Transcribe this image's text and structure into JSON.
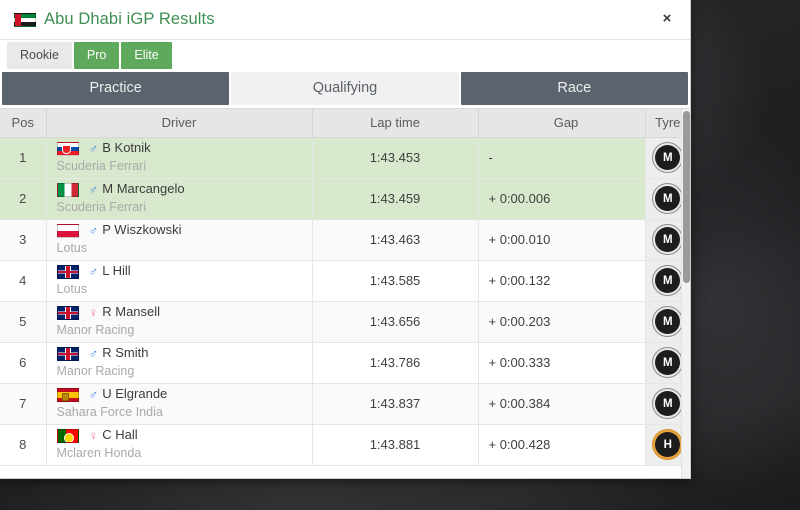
{
  "dialog": {
    "title": "Abu Dhabi iGP Results",
    "title_flag": "uae-flag",
    "close_label": "×"
  },
  "tiers": [
    {
      "label": "Rookie",
      "active": false
    },
    {
      "label": "Pro",
      "active": true
    },
    {
      "label": "Elite",
      "active": true
    }
  ],
  "tabs": [
    {
      "label": "Practice",
      "active": false
    },
    {
      "label": "Qualifying",
      "active": true
    },
    {
      "label": "Race",
      "active": false
    }
  ],
  "table": {
    "headers": [
      "Pos",
      "Driver",
      "Lap time",
      "Gap",
      "Tyre"
    ],
    "rows": [
      {
        "pos": "1",
        "flag": "svk",
        "gender": "male",
        "name": "B Kotnik",
        "team": "Scuderia Ferrari",
        "lap": "1:43.453",
        "gap": "-",
        "tyre": "M",
        "highlight": true
      },
      {
        "pos": "2",
        "flag": "ita",
        "gender": "male",
        "name": "M Marcangelo",
        "team": "Scuderia Ferrari",
        "lap": "1:43.459",
        "gap": "+ 0:00.006",
        "tyre": "M",
        "highlight": true
      },
      {
        "pos": "3",
        "flag": "pol",
        "gender": "male",
        "name": "P Wiszkowski",
        "team": "Lotus",
        "lap": "1:43.463",
        "gap": "+ 0:00.010",
        "tyre": "M",
        "highlight": false
      },
      {
        "pos": "4",
        "flag": "gbr",
        "gender": "male",
        "name": "L Hill",
        "team": "Lotus",
        "lap": "1:43.585",
        "gap": "+ 0:00.132",
        "tyre": "M",
        "highlight": false
      },
      {
        "pos": "5",
        "flag": "gbr",
        "gender": "female",
        "name": "R Mansell",
        "team": "Manor Racing",
        "lap": "1:43.656",
        "gap": "+ 0:00.203",
        "tyre": "M",
        "highlight": false
      },
      {
        "pos": "6",
        "flag": "gbr",
        "gender": "male",
        "name": "R Smith",
        "team": "Manor Racing",
        "lap": "1:43.786",
        "gap": "+ 0:00.333",
        "tyre": "M",
        "highlight": false
      },
      {
        "pos": "7",
        "flag": "esp",
        "gender": "male",
        "name": "U Elgrande",
        "team": "Sahara Force India",
        "lap": "1:43.837",
        "gap": "+ 0:00.384",
        "tyre": "M",
        "highlight": false
      },
      {
        "pos": "8",
        "flag": "prt",
        "gender": "female",
        "name": "C Hall",
        "team": "Mclaren Honda",
        "lap": "1:43.881",
        "gap": "+ 0:00.428",
        "tyre": "H",
        "highlight": false
      }
    ]
  },
  "colors": {
    "brand_green": "#3f8f52",
    "tier_active": "#5ea95b",
    "tab_inactive": "#5b636e",
    "row_highlight": "#d8e8cc",
    "tyre_medium": "#1d1d1d",
    "tyre_hard_ring": "#e8a33d",
    "gender_male": "#4a90e2",
    "gender_female": "#e87aa8"
  }
}
